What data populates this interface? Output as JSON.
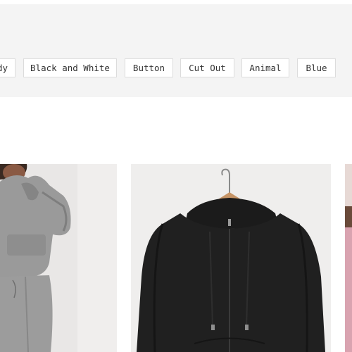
{
  "tags": [
    {
      "label": "dy"
    },
    {
      "label": "Black and White"
    },
    {
      "label": "Button"
    },
    {
      "label": "Cut Out"
    },
    {
      "label": "Animal"
    },
    {
      "label": "Blue"
    }
  ],
  "products": [
    {
      "image": "grey-hoodie-tracksuit-photo"
    },
    {
      "image": "black-zip-hoodie-on-hanger-photo"
    },
    {
      "image": "pink-product-photo-partial"
    }
  ],
  "colors": {
    "tag_bar_bg": "#f4f4f4",
    "tag_border": "#dcdcdc"
  }
}
